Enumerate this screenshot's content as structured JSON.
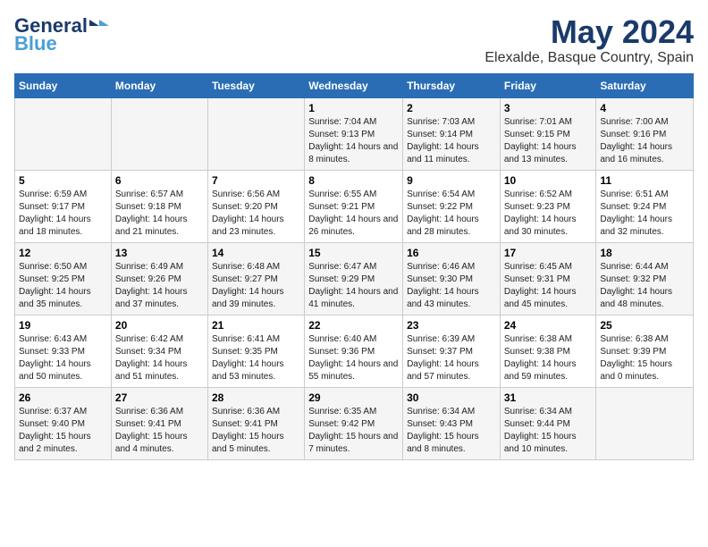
{
  "logo": {
    "line1": "General",
    "line2": "Blue",
    "icon": "▶"
  },
  "title": "May 2024",
  "location": "Elexalde, Basque Country, Spain",
  "days_of_week": [
    "Sunday",
    "Monday",
    "Tuesday",
    "Wednesday",
    "Thursday",
    "Friday",
    "Saturday"
  ],
  "weeks": [
    [
      {
        "day": "",
        "sunrise": "",
        "sunset": "",
        "daylight": ""
      },
      {
        "day": "",
        "sunrise": "",
        "sunset": "",
        "daylight": ""
      },
      {
        "day": "",
        "sunrise": "",
        "sunset": "",
        "daylight": ""
      },
      {
        "day": "1",
        "sunrise": "Sunrise: 7:04 AM",
        "sunset": "Sunset: 9:13 PM",
        "daylight": "Daylight: 14 hours and 8 minutes."
      },
      {
        "day": "2",
        "sunrise": "Sunrise: 7:03 AM",
        "sunset": "Sunset: 9:14 PM",
        "daylight": "Daylight: 14 hours and 11 minutes."
      },
      {
        "day": "3",
        "sunrise": "Sunrise: 7:01 AM",
        "sunset": "Sunset: 9:15 PM",
        "daylight": "Daylight: 14 hours and 13 minutes."
      },
      {
        "day": "4",
        "sunrise": "Sunrise: 7:00 AM",
        "sunset": "Sunset: 9:16 PM",
        "daylight": "Daylight: 14 hours and 16 minutes."
      }
    ],
    [
      {
        "day": "5",
        "sunrise": "Sunrise: 6:59 AM",
        "sunset": "Sunset: 9:17 PM",
        "daylight": "Daylight: 14 hours and 18 minutes."
      },
      {
        "day": "6",
        "sunrise": "Sunrise: 6:57 AM",
        "sunset": "Sunset: 9:18 PM",
        "daylight": "Daylight: 14 hours and 21 minutes."
      },
      {
        "day": "7",
        "sunrise": "Sunrise: 6:56 AM",
        "sunset": "Sunset: 9:20 PM",
        "daylight": "Daylight: 14 hours and 23 minutes."
      },
      {
        "day": "8",
        "sunrise": "Sunrise: 6:55 AM",
        "sunset": "Sunset: 9:21 PM",
        "daylight": "Daylight: 14 hours and 26 minutes."
      },
      {
        "day": "9",
        "sunrise": "Sunrise: 6:54 AM",
        "sunset": "Sunset: 9:22 PM",
        "daylight": "Daylight: 14 hours and 28 minutes."
      },
      {
        "day": "10",
        "sunrise": "Sunrise: 6:52 AM",
        "sunset": "Sunset: 9:23 PM",
        "daylight": "Daylight: 14 hours and 30 minutes."
      },
      {
        "day": "11",
        "sunrise": "Sunrise: 6:51 AM",
        "sunset": "Sunset: 9:24 PM",
        "daylight": "Daylight: 14 hours and 32 minutes."
      }
    ],
    [
      {
        "day": "12",
        "sunrise": "Sunrise: 6:50 AM",
        "sunset": "Sunset: 9:25 PM",
        "daylight": "Daylight: 14 hours and 35 minutes."
      },
      {
        "day": "13",
        "sunrise": "Sunrise: 6:49 AM",
        "sunset": "Sunset: 9:26 PM",
        "daylight": "Daylight: 14 hours and 37 minutes."
      },
      {
        "day": "14",
        "sunrise": "Sunrise: 6:48 AM",
        "sunset": "Sunset: 9:27 PM",
        "daylight": "Daylight: 14 hours and 39 minutes."
      },
      {
        "day": "15",
        "sunrise": "Sunrise: 6:47 AM",
        "sunset": "Sunset: 9:29 PM",
        "daylight": "Daylight: 14 hours and 41 minutes."
      },
      {
        "day": "16",
        "sunrise": "Sunrise: 6:46 AM",
        "sunset": "Sunset: 9:30 PM",
        "daylight": "Daylight: 14 hours and 43 minutes."
      },
      {
        "day": "17",
        "sunrise": "Sunrise: 6:45 AM",
        "sunset": "Sunset: 9:31 PM",
        "daylight": "Daylight: 14 hours and 45 minutes."
      },
      {
        "day": "18",
        "sunrise": "Sunrise: 6:44 AM",
        "sunset": "Sunset: 9:32 PM",
        "daylight": "Daylight: 14 hours and 48 minutes."
      }
    ],
    [
      {
        "day": "19",
        "sunrise": "Sunrise: 6:43 AM",
        "sunset": "Sunset: 9:33 PM",
        "daylight": "Daylight: 14 hours and 50 minutes."
      },
      {
        "day": "20",
        "sunrise": "Sunrise: 6:42 AM",
        "sunset": "Sunset: 9:34 PM",
        "daylight": "Daylight: 14 hours and 51 minutes."
      },
      {
        "day": "21",
        "sunrise": "Sunrise: 6:41 AM",
        "sunset": "Sunset: 9:35 PM",
        "daylight": "Daylight: 14 hours and 53 minutes."
      },
      {
        "day": "22",
        "sunrise": "Sunrise: 6:40 AM",
        "sunset": "Sunset: 9:36 PM",
        "daylight": "Daylight: 14 hours and 55 minutes."
      },
      {
        "day": "23",
        "sunrise": "Sunrise: 6:39 AM",
        "sunset": "Sunset: 9:37 PM",
        "daylight": "Daylight: 14 hours and 57 minutes."
      },
      {
        "day": "24",
        "sunrise": "Sunrise: 6:38 AM",
        "sunset": "Sunset: 9:38 PM",
        "daylight": "Daylight: 14 hours and 59 minutes."
      },
      {
        "day": "25",
        "sunrise": "Sunrise: 6:38 AM",
        "sunset": "Sunset: 9:39 PM",
        "daylight": "Daylight: 15 hours and 0 minutes."
      }
    ],
    [
      {
        "day": "26",
        "sunrise": "Sunrise: 6:37 AM",
        "sunset": "Sunset: 9:40 PM",
        "daylight": "Daylight: 15 hours and 2 minutes."
      },
      {
        "day": "27",
        "sunrise": "Sunrise: 6:36 AM",
        "sunset": "Sunset: 9:41 PM",
        "daylight": "Daylight: 15 hours and 4 minutes."
      },
      {
        "day": "28",
        "sunrise": "Sunrise: 6:36 AM",
        "sunset": "Sunset: 9:41 PM",
        "daylight": "Daylight: 15 hours and 5 minutes."
      },
      {
        "day": "29",
        "sunrise": "Sunrise: 6:35 AM",
        "sunset": "Sunset: 9:42 PM",
        "daylight": "Daylight: 15 hours and 7 minutes."
      },
      {
        "day": "30",
        "sunrise": "Sunrise: 6:34 AM",
        "sunset": "Sunset: 9:43 PM",
        "daylight": "Daylight: 15 hours and 8 minutes."
      },
      {
        "day": "31",
        "sunrise": "Sunrise: 6:34 AM",
        "sunset": "Sunset: 9:44 PM",
        "daylight": "Daylight: 15 hours and 10 minutes."
      },
      {
        "day": "",
        "sunrise": "",
        "sunset": "",
        "daylight": ""
      }
    ]
  ]
}
